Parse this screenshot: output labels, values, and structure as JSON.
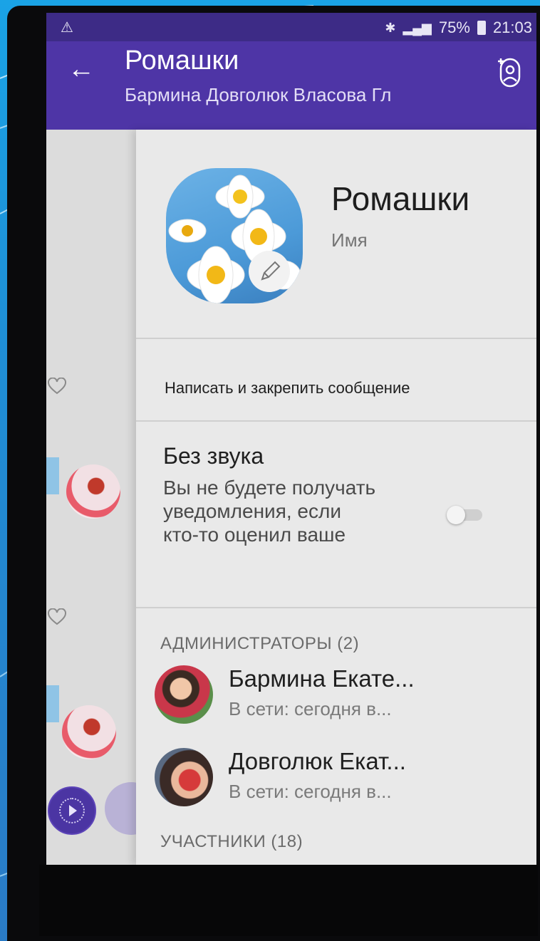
{
  "status_bar": {
    "battery": "75%",
    "time": "21:03"
  },
  "header": {
    "back_icon": "arrow-left-icon",
    "title": "Ромашки",
    "subtitle": "Бармина Довголюк Власова Гл",
    "add_participant_icon": "add-user-icon"
  },
  "group_info": {
    "name": "Ромашки",
    "name_label": "Имя",
    "avatar_icon": "daisies-photo",
    "edit_icon": "pencil-icon"
  },
  "pin_message": {
    "label": "Написать и закрепить сообщение"
  },
  "mute": {
    "title": "Без звука",
    "description": "Вы не будете получать уведомления, если кто-то оценил ваше",
    "enabled": false
  },
  "admins": {
    "header": "АДМИНИСТРАТОРЫ (2)",
    "items": [
      {
        "name": "Бармина Екате...",
        "status": "В сети: сегодня в..."
      },
      {
        "name": "Довголюк Екат...",
        "status": "В сети: сегодня в..."
      }
    ]
  },
  "participants": {
    "header": "УЧАСТНИКИ (18)"
  },
  "colors": {
    "header": "#4e35a6",
    "status_bar": "#3d2b86",
    "panel": "#e9e9e9"
  }
}
